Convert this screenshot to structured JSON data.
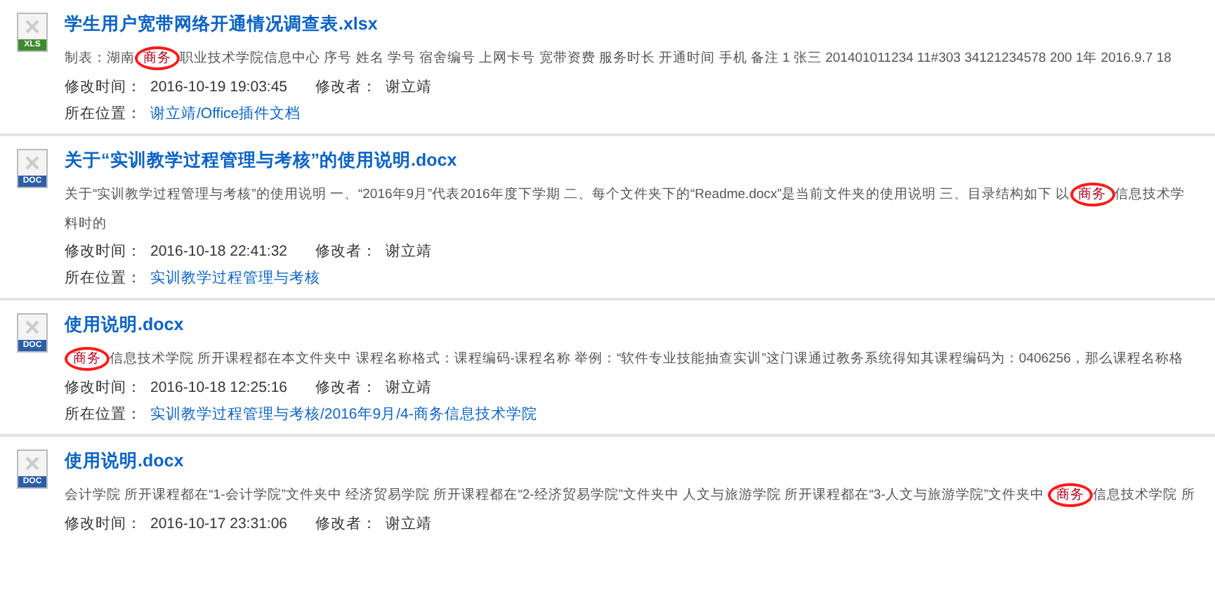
{
  "results": [
    {
      "kind": "spreadsheet",
      "file_type": "XLS",
      "title": "学生用户宽带网络开通情况调查表.xlsx",
      "snippet_lines": [
        [
          {
            "text": "制表：湖南",
            "highlight": false
          },
          {
            "text": "商务",
            "highlight": true,
            "circled": true
          },
          {
            "text": "职业技术学院信息中心 序号 姓名 学号 宿舍编号 上网卡号 宽带资费 服务时长 开通时间 手机 备注 1 张三 201401011234 11#303 34121234578 200 1年 2016.9.7 18",
            "highlight": false
          }
        ]
      ],
      "modified_label": "修改时间：",
      "modified": "2016-10-19 19:03:45",
      "modifier_label": "修改者：",
      "modifier": "谢立靖",
      "location_label": "所在位置：",
      "location": "谢立靖/Office插件文档"
    },
    {
      "kind": "document",
      "file_type": "DOC",
      "title": "关于“实训教学过程管理与考核”的使用说明.docx",
      "snippet_lines": [
        [
          {
            "text": "关于“实训教学过程管理与考核”的使用说明 一、“2016年9月”代表2016年度下学期 二、每个文件夹下的“Readme.docx”是当前文件夹的使用说明 三、目录结构如下 以",
            "highlight": false
          },
          {
            "text": "商务",
            "highlight": true,
            "circled": true
          },
          {
            "text": "信息技术学",
            "highlight": false
          }
        ],
        [
          {
            "text": "料时的",
            "highlight": false
          }
        ]
      ],
      "modified_label": "修改时间：",
      "modified": "2016-10-18 22:41:32",
      "modifier_label": "修改者：",
      "modifier": "谢立靖",
      "location_label": "所在位置：",
      "location": "实训教学过程管理与考核"
    },
    {
      "kind": "document",
      "file_type": "DOC",
      "title": "使用说明.docx",
      "snippet_lines": [
        [
          {
            "text": "商务",
            "highlight": true,
            "circled": true
          },
          {
            "text": "信息技术学院 所开课程都在本文件夹中 课程名称格式：课程编码-课程名称 举例：“软件专业技能抽查实训”这门课通过教务系统得知其课程编码为：0406256，那么课程名称格",
            "highlight": false
          }
        ]
      ],
      "modified_label": "修改时间：",
      "modified": "2016-10-18 12:25:16",
      "modifier_label": "修改者：",
      "modifier": "谢立靖",
      "location_label": "所在位置：",
      "location": "实训教学过程管理与考核/2016年9月/4-商务信息技术学院"
    },
    {
      "kind": "document",
      "file_type": "DOC",
      "title": "使用说明.docx",
      "snippet_lines": [
        [
          {
            "text": "会计学院 所开课程都在“1-会计学院”文件夹中 经济贸易学院 所开课程都在“2-经济贸易学院”文件夹中 人文与旅游学院 所开课程都在“3-人文与旅游学院”文件夹中 ",
            "highlight": false
          },
          {
            "text": "商务",
            "highlight": true,
            "circled": true
          },
          {
            "text": "信息技术学院 所",
            "highlight": false
          }
        ]
      ],
      "modified_label": "修改时间：",
      "modified": "2016-10-17 23:31:06",
      "modifier_label": "修改者：",
      "modifier": "谢立靖"
    }
  ]
}
